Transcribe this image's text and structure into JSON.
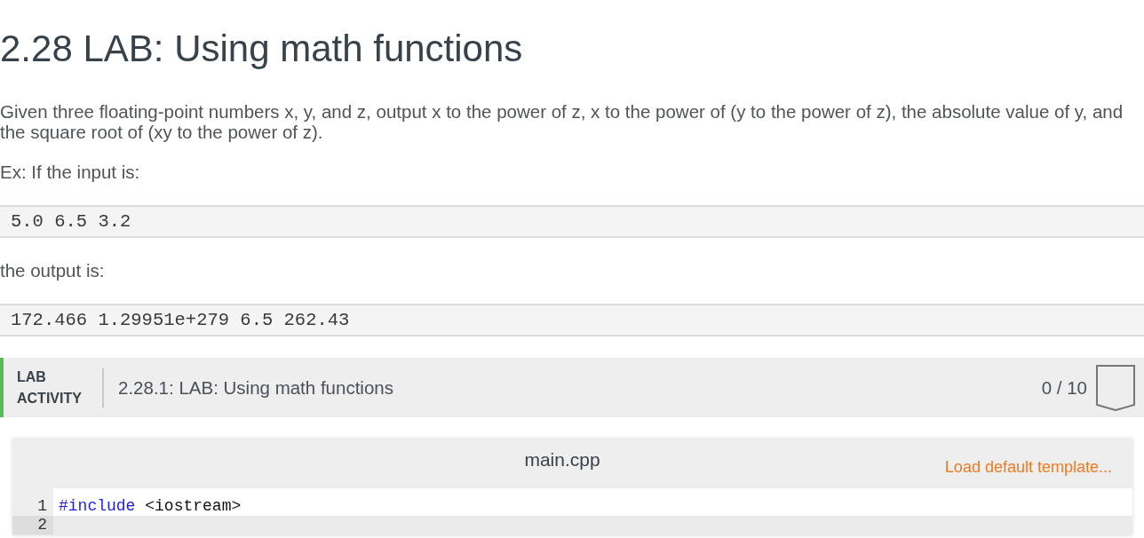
{
  "heading": "2.28 LAB: Using math functions",
  "description": "Given three floating-point numbers x, y, and z, output x to the power of z, x to the power of (y to the power of z), the absolute value of y, and the square root of (xy to the power of z).",
  "example_intro": "Ex: If the input is:",
  "example_input": "5.0 6.5 3.2",
  "output_intro": "the output is:",
  "example_output": "172.466 1.29951e+279 6.5 262.43",
  "lab_activity": {
    "label": "LAB ACTIVITY",
    "title": "2.28.1: LAB: Using math functions",
    "score": "0 / 10",
    "completed": false
  },
  "editor": {
    "filename": "main.cpp",
    "load_template_link": "Load default template...",
    "lines": [
      {
        "number": "1",
        "active": false,
        "tokens": [
          {
            "kind": "directive",
            "text": "#include"
          },
          {
            "kind": "plain",
            "text": " <iostream>"
          }
        ]
      },
      {
        "number": "2",
        "active": true
      }
    ]
  }
}
